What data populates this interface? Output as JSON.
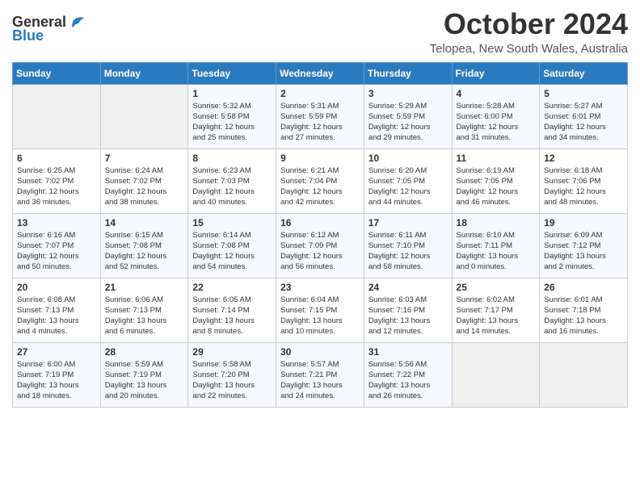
{
  "header": {
    "logo_line1": "General",
    "logo_line2": "Blue",
    "month": "October 2024",
    "location": "Telopea, New South Wales, Australia"
  },
  "weekdays": [
    "Sunday",
    "Monday",
    "Tuesday",
    "Wednesday",
    "Thursday",
    "Friday",
    "Saturday"
  ],
  "weeks": [
    [
      {
        "day": "",
        "info": ""
      },
      {
        "day": "",
        "info": ""
      },
      {
        "day": "1",
        "info": "Sunrise: 5:32 AM\nSunset: 5:58 PM\nDaylight: 12 hours\nand 25 minutes."
      },
      {
        "day": "2",
        "info": "Sunrise: 5:31 AM\nSunset: 5:59 PM\nDaylight: 12 hours\nand 27 minutes."
      },
      {
        "day": "3",
        "info": "Sunrise: 5:29 AM\nSunset: 5:59 PM\nDaylight: 12 hours\nand 29 minutes."
      },
      {
        "day": "4",
        "info": "Sunrise: 5:28 AM\nSunset: 6:00 PM\nDaylight: 12 hours\nand 31 minutes."
      },
      {
        "day": "5",
        "info": "Sunrise: 5:27 AM\nSunset: 6:01 PM\nDaylight: 12 hours\nand 34 minutes."
      }
    ],
    [
      {
        "day": "6",
        "info": "Sunrise: 6:25 AM\nSunset: 7:02 PM\nDaylight: 12 hours\nand 36 minutes."
      },
      {
        "day": "7",
        "info": "Sunrise: 6:24 AM\nSunset: 7:02 PM\nDaylight: 12 hours\nand 38 minutes."
      },
      {
        "day": "8",
        "info": "Sunrise: 6:23 AM\nSunset: 7:03 PM\nDaylight: 12 hours\nand 40 minutes."
      },
      {
        "day": "9",
        "info": "Sunrise: 6:21 AM\nSunset: 7:04 PM\nDaylight: 12 hours\nand 42 minutes."
      },
      {
        "day": "10",
        "info": "Sunrise: 6:20 AM\nSunset: 7:05 PM\nDaylight: 12 hours\nand 44 minutes."
      },
      {
        "day": "11",
        "info": "Sunrise: 6:19 AM\nSunset: 7:05 PM\nDaylight: 12 hours\nand 46 minutes."
      },
      {
        "day": "12",
        "info": "Sunrise: 6:18 AM\nSunset: 7:06 PM\nDaylight: 12 hours\nand 48 minutes."
      }
    ],
    [
      {
        "day": "13",
        "info": "Sunrise: 6:16 AM\nSunset: 7:07 PM\nDaylight: 12 hours\nand 50 minutes."
      },
      {
        "day": "14",
        "info": "Sunrise: 6:15 AM\nSunset: 7:08 PM\nDaylight: 12 hours\nand 52 minutes."
      },
      {
        "day": "15",
        "info": "Sunrise: 6:14 AM\nSunset: 7:08 PM\nDaylight: 12 hours\nand 54 minutes."
      },
      {
        "day": "16",
        "info": "Sunrise: 6:12 AM\nSunset: 7:09 PM\nDaylight: 12 hours\nand 56 minutes."
      },
      {
        "day": "17",
        "info": "Sunrise: 6:11 AM\nSunset: 7:10 PM\nDaylight: 12 hours\nand 58 minutes."
      },
      {
        "day": "18",
        "info": "Sunrise: 6:10 AM\nSunset: 7:11 PM\nDaylight: 13 hours\nand 0 minutes."
      },
      {
        "day": "19",
        "info": "Sunrise: 6:09 AM\nSunset: 7:12 PM\nDaylight: 13 hours\nand 2 minutes."
      }
    ],
    [
      {
        "day": "20",
        "info": "Sunrise: 6:08 AM\nSunset: 7:13 PM\nDaylight: 13 hours\nand 4 minutes."
      },
      {
        "day": "21",
        "info": "Sunrise: 6:06 AM\nSunset: 7:13 PM\nDaylight: 13 hours\nand 6 minutes."
      },
      {
        "day": "22",
        "info": "Sunrise: 6:05 AM\nSunset: 7:14 PM\nDaylight: 13 hours\nand 8 minutes."
      },
      {
        "day": "23",
        "info": "Sunrise: 6:04 AM\nSunset: 7:15 PM\nDaylight: 13 hours\nand 10 minutes."
      },
      {
        "day": "24",
        "info": "Sunrise: 6:03 AM\nSunset: 7:16 PM\nDaylight: 13 hours\nand 12 minutes."
      },
      {
        "day": "25",
        "info": "Sunrise: 6:02 AM\nSunset: 7:17 PM\nDaylight: 13 hours\nand 14 minutes."
      },
      {
        "day": "26",
        "info": "Sunrise: 6:01 AM\nSunset: 7:18 PM\nDaylight: 13 hours\nand 16 minutes."
      }
    ],
    [
      {
        "day": "27",
        "info": "Sunrise: 6:00 AM\nSunset: 7:19 PM\nDaylight: 13 hours\nand 18 minutes."
      },
      {
        "day": "28",
        "info": "Sunrise: 5:59 AM\nSunset: 7:19 PM\nDaylight: 13 hours\nand 20 minutes."
      },
      {
        "day": "29",
        "info": "Sunrise: 5:58 AM\nSunset: 7:20 PM\nDaylight: 13 hours\nand 22 minutes."
      },
      {
        "day": "30",
        "info": "Sunrise: 5:57 AM\nSunset: 7:21 PM\nDaylight: 13 hours\nand 24 minutes."
      },
      {
        "day": "31",
        "info": "Sunrise: 5:56 AM\nSunset: 7:22 PM\nDaylight: 13 hours\nand 26 minutes."
      },
      {
        "day": "",
        "info": ""
      },
      {
        "day": "",
        "info": ""
      }
    ]
  ]
}
